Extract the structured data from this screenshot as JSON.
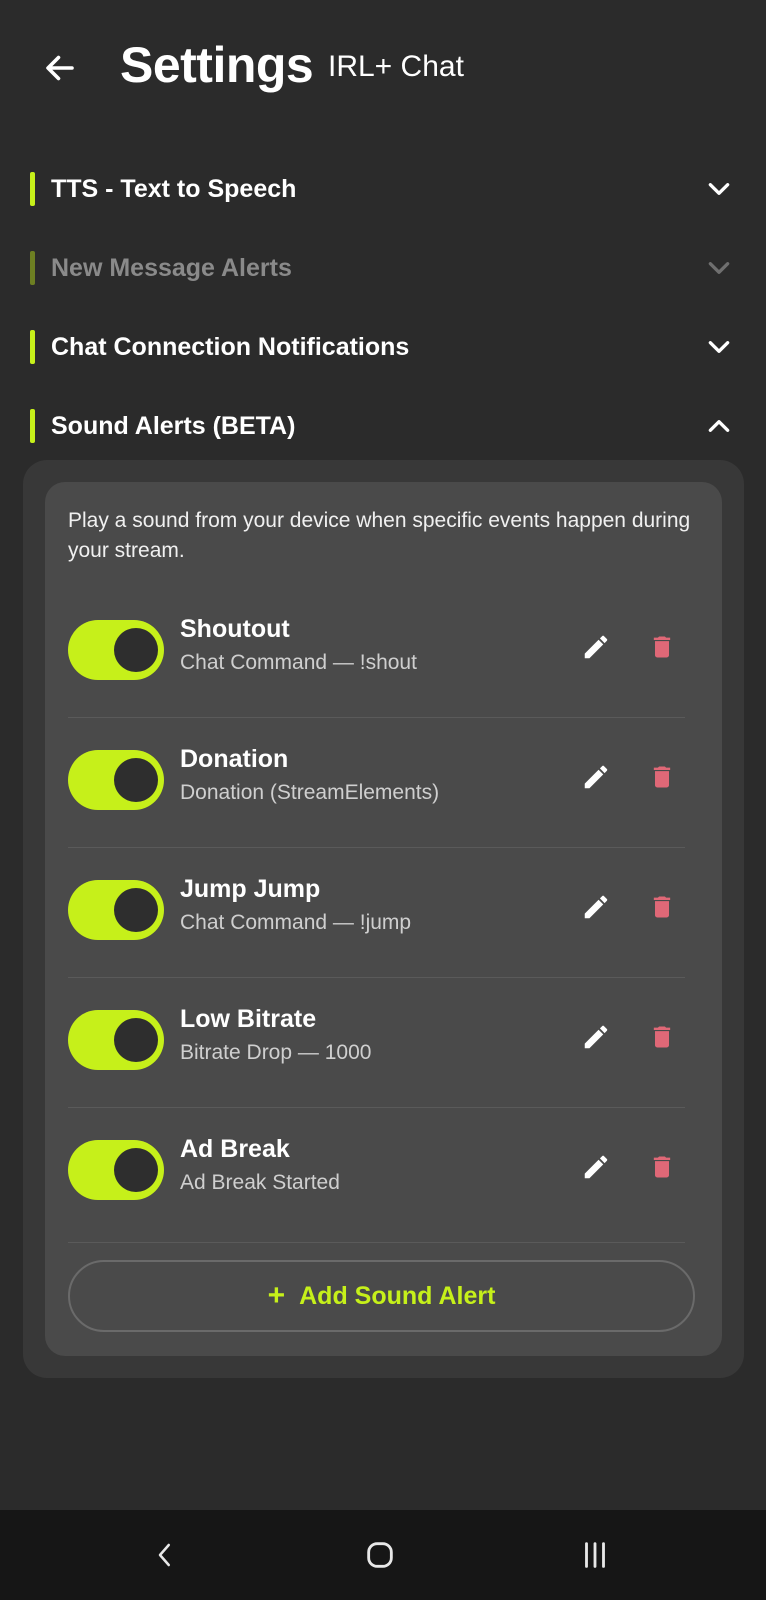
{
  "header": {
    "title": "Settings",
    "subtitle": "IRL+ Chat"
  },
  "sections": [
    {
      "label": "TTS - Text to Speech",
      "state": "collapsed"
    },
    {
      "label": "New Message Alerts",
      "state": "collapsed-disabled"
    },
    {
      "label": "Chat Connection Notifications",
      "state": "collapsed"
    },
    {
      "label": "Sound Alerts (BETA)",
      "state": "expanded"
    }
  ],
  "sound_alerts": {
    "description": "Play a sound from your device when specific events happen during your stream.",
    "items": [
      {
        "name": "Shoutout",
        "detail": "Chat Command — !shout",
        "enabled": true
      },
      {
        "name": "Donation",
        "detail": "Donation (StreamElements)",
        "enabled": true
      },
      {
        "name": "Jump Jump",
        "detail": "Chat Command — !jump",
        "enabled": true
      },
      {
        "name": "Low Bitrate",
        "detail": "Bitrate Drop — 1000",
        "enabled": true
      },
      {
        "name": "Ad Break",
        "detail": "Ad Break Started",
        "enabled": true
      }
    ],
    "add_label": "Add Sound Alert"
  },
  "colors": {
    "accent": "#c6f01a",
    "background": "#2b2b2b",
    "delete": "#e06877"
  },
  "icons": {
    "back": "arrow-left-icon",
    "chevron_down": "chevron-down-icon",
    "chevron_up": "chevron-up-icon",
    "edit": "pencil-icon",
    "delete": "trash-icon",
    "add": "plus-icon",
    "nav_back": "nav-back-icon",
    "nav_home": "nav-home-icon",
    "nav_recents": "nav-recents-icon"
  }
}
